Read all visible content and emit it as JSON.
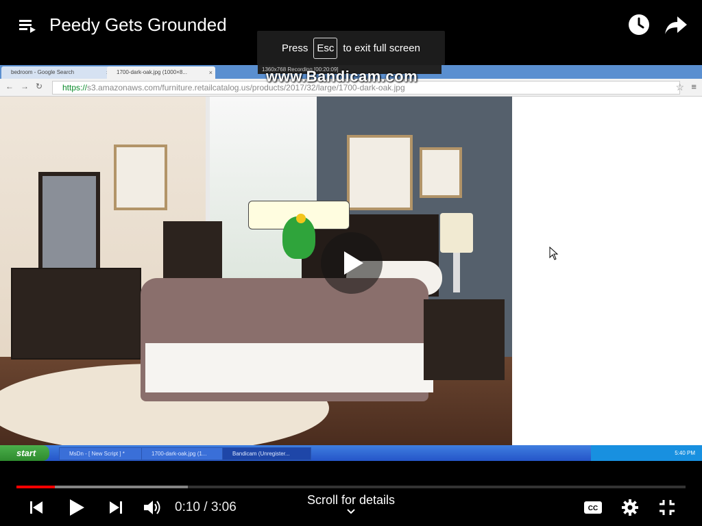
{
  "top": {
    "title": "Peedy Gets Grounded"
  },
  "toast": {
    "pre": "Press",
    "key": "Esc",
    "post": "to exit full screen"
  },
  "video": {
    "browser": {
      "tabs": [
        {
          "label": "bedroom - Google Search"
        },
        {
          "label": "1700-dark-oak.jpg (1000×8..."
        }
      ],
      "url_scheme": "https://",
      "url_rest": "s3.amazonaws.com/furniture.retailcatalog.us/products/2017/32/large/1700-dark-oak.jpg"
    },
    "recorder": {
      "strip": "1360x768   Recording [00:20:09]",
      "watermark": "www.Bandicam.com"
    },
    "taskbar": {
      "start": "start",
      "items": [
        {
          "label": "MsDn - [ New Script ] *"
        },
        {
          "label": "1700-dark-oak.jpg (1..."
        },
        {
          "label": "Bandicam (Unregister..."
        }
      ],
      "clock": "5:40 PM"
    }
  },
  "player": {
    "progress_played": 0.057,
    "progress_buffered": 0.256,
    "time_current": "0:10",
    "time_total": "3:06",
    "time_display": "0:10 / 3:06",
    "scroll_hint": "Scroll for details"
  },
  "colors": {
    "accent": "#ff0000",
    "background": "#000000"
  },
  "icons": [
    "playlist-menu-icon",
    "watch-later-clock-icon",
    "share-arrow-icon",
    "previous-icon",
    "play-icon",
    "next-icon",
    "volume-icon",
    "captions-icon",
    "settings-gear-icon",
    "exit-fullscreen-icon",
    "chevron-down-icon"
  ]
}
